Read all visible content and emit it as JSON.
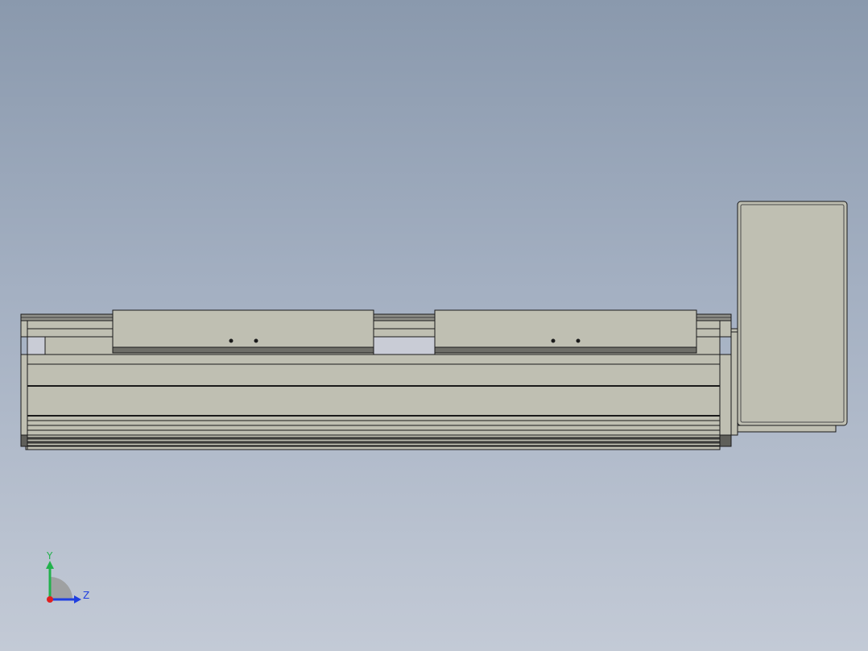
{
  "scene": {
    "background_top": "#8a99ad",
    "background_bottom": "#c3cad6",
    "part_fill": "#bfbfb2",
    "edge_color": "#1a1a1a",
    "shadow_fill": "#6e6e68"
  },
  "triad": {
    "y_label": "Y",
    "z_label": "Z",
    "y_color": "#22b14c",
    "z_color": "#1f3fe0",
    "x_color": "#e01f1f"
  }
}
